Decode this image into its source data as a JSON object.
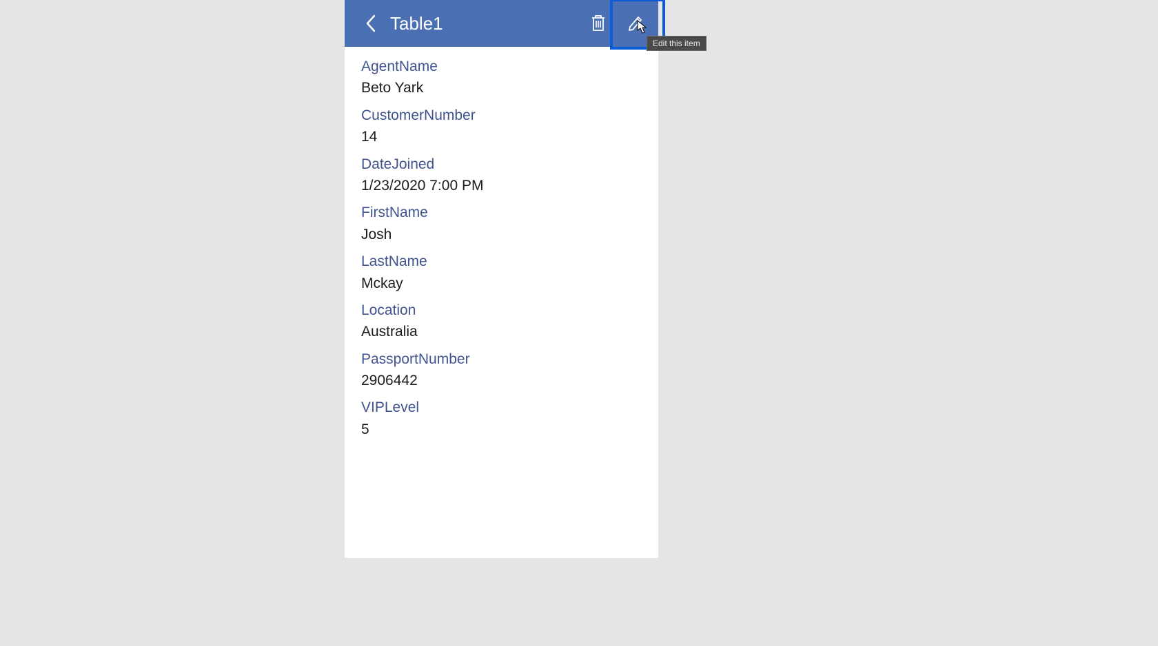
{
  "header": {
    "title": "Table1"
  },
  "tooltip": "Edit this item",
  "fields": [
    {
      "label": "AgentName",
      "value": "Beto Yark"
    },
    {
      "label": "CustomerNumber",
      "value": "14"
    },
    {
      "label": "DateJoined",
      "value": "1/23/2020 7:00 PM"
    },
    {
      "label": "FirstName",
      "value": "Josh"
    },
    {
      "label": "LastName",
      "value": "Mckay"
    },
    {
      "label": "Location",
      "value": "Australia"
    },
    {
      "label": "PassportNumber",
      "value": "2906442"
    },
    {
      "label": "VIPLevel",
      "value": "5"
    }
  ]
}
